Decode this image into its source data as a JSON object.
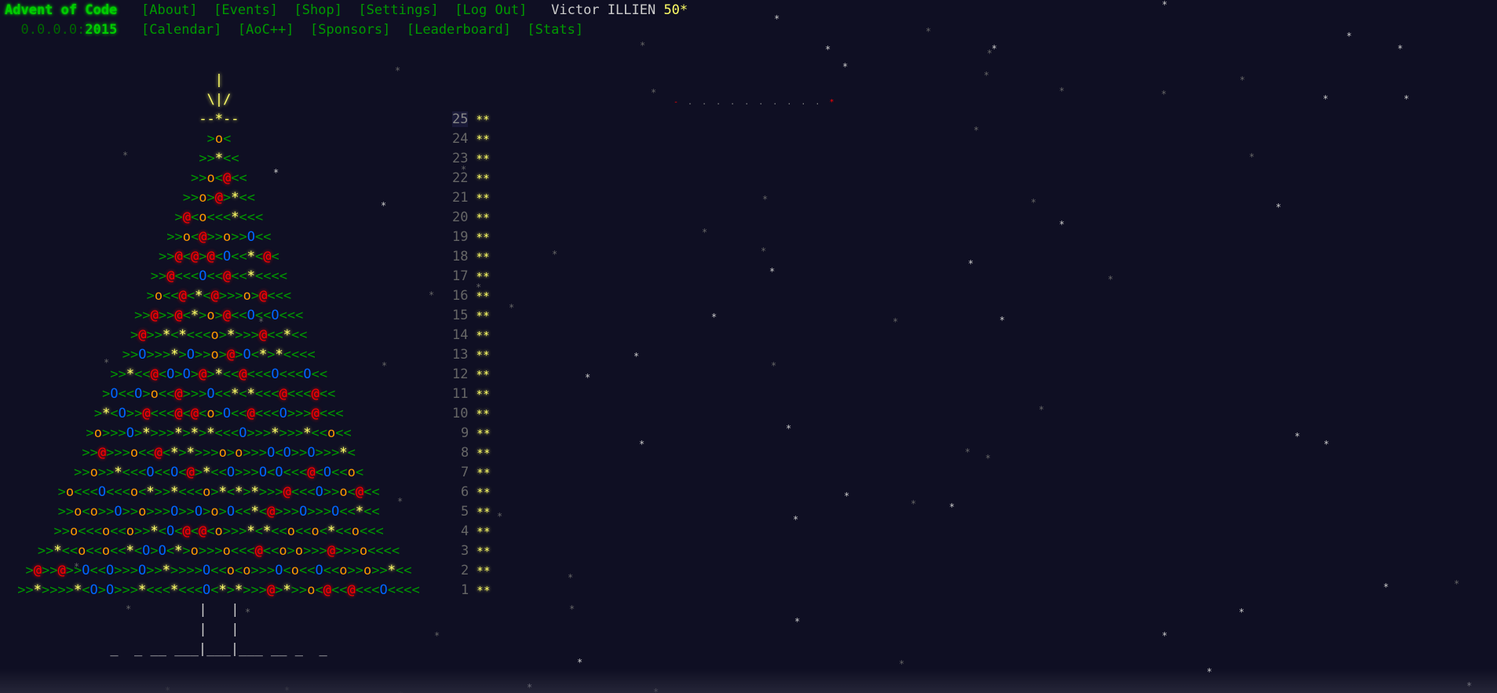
{
  "header": {
    "site_title": "Advent of Code",
    "nav_row1": [
      "[About]",
      "[Events]",
      "[Shop]",
      "[Settings]",
      "[Log Out]"
    ],
    "user_name": "Victor ILLIEN",
    "user_stars": "50*",
    "ip_prefix": "0.0.0.0:",
    "year": "2015",
    "nav_row2": [
      "[Calendar]",
      "[AoC++]",
      "[Sponsors]",
      "[Leaderboard]",
      "[Stats]"
    ]
  },
  "tree": {
    "top_lines": [
      "|",
      "\\|/",
      "--*--"
    ],
    "rows": [
      ">o<",
      ">>*<<",
      ">>o<@<<",
      ">>o>@>*<<",
      ">@<o<<<*<<<",
      ">>o<@>>o>>O<<",
      ">>@<@>@<O<<*<@<",
      ">>@<<<O<<@<<*<<<<",
      ">o<<@<*<@>>>o>@<<<",
      ">>@>>@<*>o>@<<O<<O<<<",
      ">@>>*<*<<<o>*>>>@<<*<<",
      ">>O>>>*>O>>o>@>O<*>*<<<<",
      ">>*<<@<O>O>@>*<<@<<<O<<<O<<",
      ">O<<O>o<<@>>>O<<*<*<<<@<<<@<<",
      ">*<O>>@<<<@<@<o>O<<@<<<O>>>@<<<",
      ">o>>>O>*>>>*>*>*<<<O>>>*>>>*<<o<<",
      ">>@>>>o<<@<*>*>>>o>o>>>O<O>>O>>>*<",
      ">>o>>*<<<O<<O<@>*<<O>>>O<O<<<@<O<<o<",
      ">o<<<O<<<o<*>>*<<<o>*<*>*>>>@<<<O>>o<@<<",
      ">>o<o>>O>>o>>>O>>O>o>O<<*<@>>>O>>>O<<*<<",
      ">>o<<<o<<o>>*<O<@<@<o>>>*<*<<o<<o<*<<o<<<",
      ">>*<<o<<o<<*<O>O<*>o>>>o<<<@<<o>o>>>@>>>o<<<<",
      ">@>>@>>O<<O>>>O>>*>>>>O<<o<o>>>O<o<<O<<o>>o>>*<<",
      ">>*>>>>*<O>O>>>*<<<*<<<O<*>*>>>@>*>>o<@<<@<<<O<<<<"
    ],
    "trunk": [
      "|   |",
      "|   |",
      "_  _ __ ___|___|___ __ _  _"
    ]
  },
  "days": [
    {
      "num": "25",
      "stars": "**"
    },
    {
      "num": "24",
      "stars": "**"
    },
    {
      "num": "23",
      "stars": "**"
    },
    {
      "num": "22",
      "stars": "**"
    },
    {
      "num": "21",
      "stars": "**"
    },
    {
      "num": "20",
      "stars": "**"
    },
    {
      "num": "19",
      "stars": "**"
    },
    {
      "num": "18",
      "stars": "**"
    },
    {
      "num": "17",
      "stars": "**"
    },
    {
      "num": "16",
      "stars": "**"
    },
    {
      "num": "15",
      "stars": "**"
    },
    {
      "num": "14",
      "stars": "**"
    },
    {
      "num": "13",
      "stars": "**"
    },
    {
      "num": "12",
      "stars": "**"
    },
    {
      "num": "11",
      "stars": "**"
    },
    {
      "num": "10",
      "stars": "**"
    },
    {
      "num": "9",
      "stars": "**"
    },
    {
      "num": "8",
      "stars": "**"
    },
    {
      "num": "7",
      "stars": "**"
    },
    {
      "num": "6",
      "stars": "**"
    },
    {
      "num": "5",
      "stars": "**"
    },
    {
      "num": "4",
      "stars": "**"
    },
    {
      "num": "3",
      "stars": "**"
    },
    {
      "num": "2",
      "stars": "**"
    },
    {
      "num": "1",
      "stars": "**"
    }
  ],
  "colors": {
    "background": "#0f0f23",
    "title_green": "#00cc00",
    "link_green": "#009900",
    "star_gold": "#ffff66",
    "ornament_red": "#ff0000",
    "ornament_orange": "#ff9900",
    "ornament_blue": "#0066ff"
  }
}
